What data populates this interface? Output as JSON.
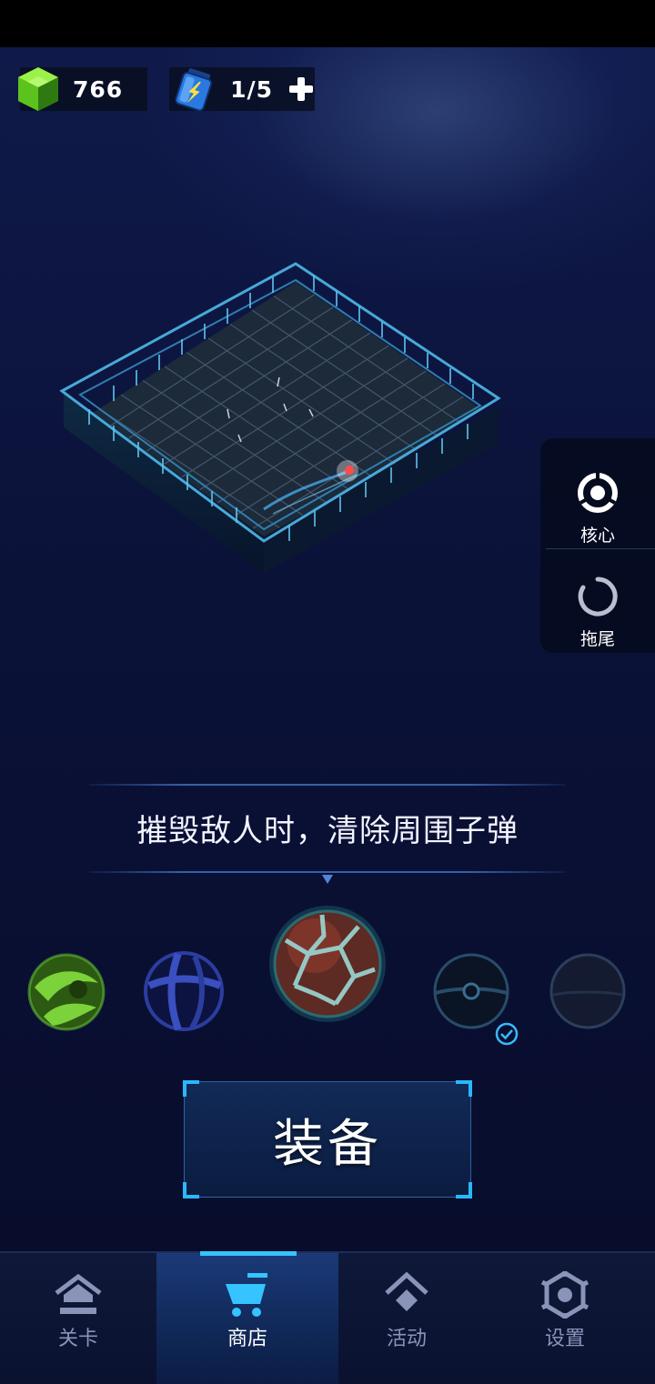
{
  "resources": {
    "gems": "766",
    "energy": "1/5"
  },
  "side_menu": {
    "core_label": "核心",
    "tail_label": "拖尾"
  },
  "description": "摧毁敌人时，清除周围子弹",
  "balls": [
    {
      "id": "green-swirl",
      "selected": false,
      "equipped": false
    },
    {
      "id": "blue-cage",
      "selected": false,
      "equipped": false
    },
    {
      "id": "red-crack",
      "selected": true,
      "equipped": false
    },
    {
      "id": "dark-pokeball",
      "selected": false,
      "equipped": true
    },
    {
      "id": "dark-plain",
      "selected": false,
      "equipped": false
    }
  ],
  "equip_button": "装备",
  "nav": {
    "levels": "关卡",
    "shop": "商店",
    "events": "活动",
    "settings": "设置",
    "active": "shop"
  },
  "colors": {
    "accent": "#29b8ff",
    "background": "#0b1033",
    "nav_active": "#1a3a78"
  }
}
